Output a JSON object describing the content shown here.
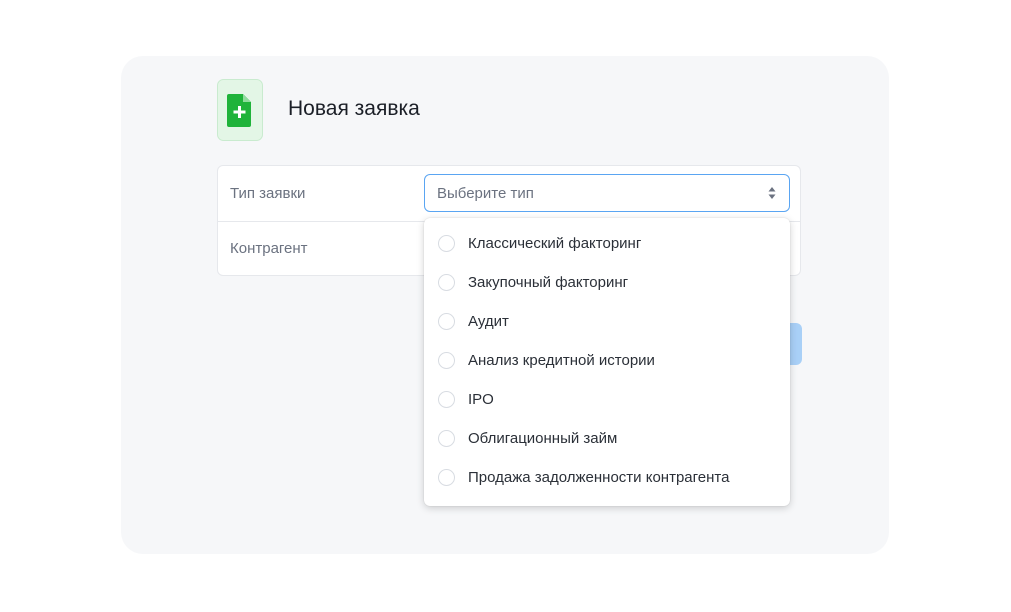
{
  "header": {
    "title": "Новая заявка",
    "icon": "file-plus-icon",
    "icon_color": "#1fb33a",
    "icon_bg": "#e3f6e6"
  },
  "form": {
    "rows": [
      {
        "label": "Тип заявки"
      },
      {
        "label": "Контрагент"
      }
    ],
    "type_select": {
      "placeholder": "Выберите тип",
      "border_color": "#5aa5f2"
    }
  },
  "dropdown": {
    "options": [
      {
        "label": "Классический факторинг"
      },
      {
        "label": "Закупочный факторинг"
      },
      {
        "label": "Аудит"
      },
      {
        "label": "Анализ кредитной истории"
      },
      {
        "label": "IPO"
      },
      {
        "label": "Облигационный займ"
      },
      {
        "label": "Продажа задолженности контрагента"
      }
    ]
  },
  "colors": {
    "card_bg": "#f6f7f9",
    "button_color": "#a9d0f7"
  }
}
